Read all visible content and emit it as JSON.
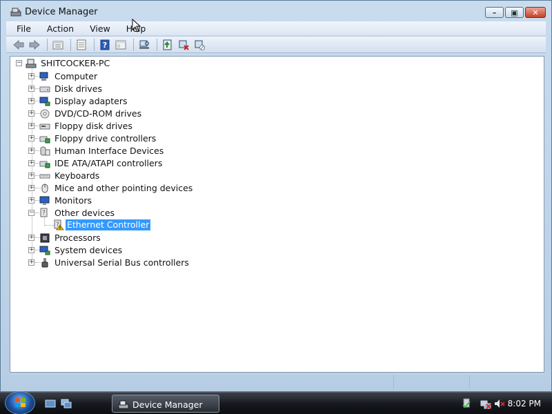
{
  "window": {
    "title": "Device Manager"
  },
  "menu": [
    "File",
    "Action",
    "View",
    "Help"
  ],
  "toolbar": {
    "buttons": [
      "back-icon",
      "forward-icon",
      "up-folder-icon",
      "properties-icon",
      "help-icon",
      "console-tree-icon",
      "scan-hardware-icon",
      "update-driver-icon",
      "uninstall-icon",
      "disable-icon"
    ]
  },
  "tree": {
    "root": "SHITCOCKER-PC",
    "categories": [
      "Computer",
      "Disk drives",
      "Display adapters",
      "DVD/CD-ROM drives",
      "Floppy disk drives",
      "Floppy drive controllers",
      "Human Interface Devices",
      "IDE ATA/ATAPI controllers",
      "Keyboards",
      "Mice and other pointing devices",
      "Monitors",
      "Other devices",
      "Processors",
      "System devices",
      "Universal Serial Bus controllers"
    ],
    "other_devices_children": [
      "Ethernet Controller"
    ],
    "selected": "Ethernet Controller",
    "expanded": "Other devices"
  },
  "taskbar": {
    "active_task": "Device Manager",
    "clock": "8:02 PM"
  },
  "colors": {
    "selection": "#3399ff",
    "warning": "#f5c400"
  }
}
